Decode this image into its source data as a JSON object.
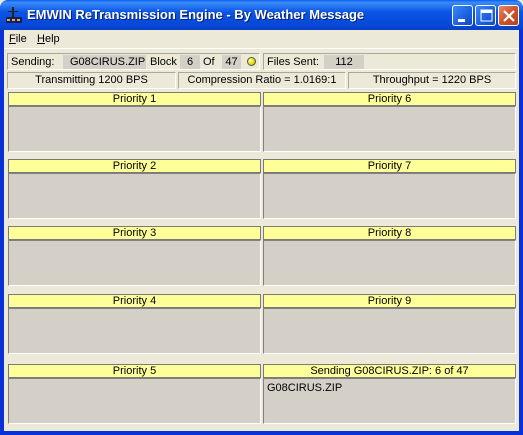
{
  "window": {
    "title": "EMWIN ReTransmission Engine - By Weather Message",
    "icon": "emwin-app-icon"
  },
  "menu": {
    "items": [
      {
        "label": "File",
        "accel": "F",
        "rest": "ile"
      },
      {
        "label": "Help",
        "accel": "H",
        "rest": "elp"
      }
    ]
  },
  "status": {
    "sending_label": "Sending:",
    "sending_file": "G08CIRUS.ZIP",
    "block_label": "Block",
    "block_current": "6",
    "of_label": "Of",
    "block_total": "47",
    "files_sent_label": "Files Sent:",
    "files_sent": "112"
  },
  "stats": {
    "transmitting": "Transmitting 1200 BPS",
    "compression": "Compression Ratio = 1.0169:1",
    "throughput": "Throughput = 1220 BPS"
  },
  "queues": [
    {
      "title": "Priority 1",
      "content": ""
    },
    {
      "title": "Priority 6",
      "content": ""
    },
    {
      "title": "Priority 2",
      "content": ""
    },
    {
      "title": "Priority 7",
      "content": ""
    },
    {
      "title": "Priority 3",
      "content": ""
    },
    {
      "title": "Priority 8",
      "content": ""
    },
    {
      "title": "Priority 4",
      "content": ""
    },
    {
      "title": "Priority 9",
      "content": ""
    },
    {
      "title": "Priority 5",
      "content": ""
    },
    {
      "title": "Sending G08CIRUS.ZIP: 6 of 47",
      "content": "G08CIRUS.ZIP"
    }
  ],
  "colors": {
    "queue_header": "#ffff99",
    "titlebar": "#0a55e6",
    "led": "#e8d800"
  }
}
